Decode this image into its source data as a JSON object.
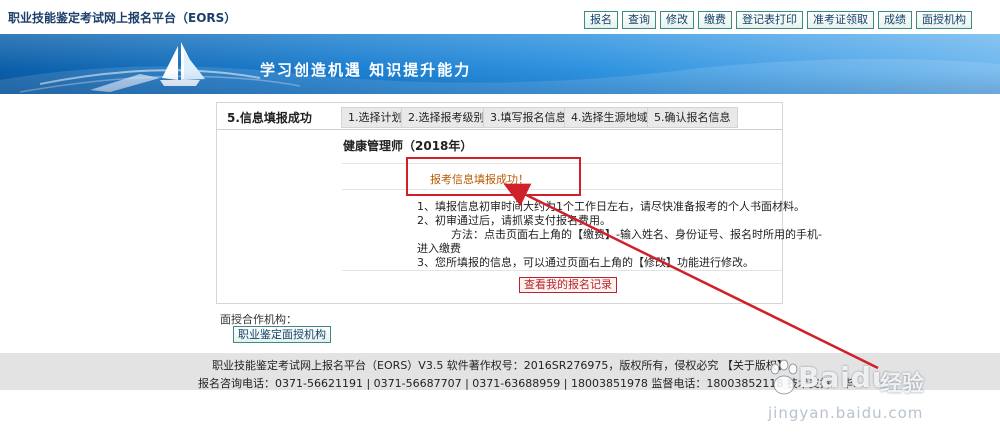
{
  "header": {
    "site_title": "职业技能鉴定考试网上报名平台（EORS）",
    "nav": [
      "报名",
      "查询",
      "修改",
      "缴费",
      "登记表打印",
      "准考证领取",
      "成绩",
      "面授机构"
    ]
  },
  "banner": {
    "motto": "学习创造机遇  知识提升能力"
  },
  "steps": {
    "current": "5.信息填报成功",
    "tabs": [
      "1.选择计划",
      "2.选择报考级别",
      "3.填写报名信息",
      "4.选择生源地域",
      "5.确认报名信息"
    ]
  },
  "main": {
    "job_title": "健康管理师（2018年）",
    "success_message": "报考信息填报成功！",
    "instructions": [
      "1、填报信息初审时间大约为1个工作日左右，请尽快准备报考的个人书面材料。",
      "2、初审通过后，请抓紧支付报名费用。",
      "方法：点击页面右上角的【缴费】-输入姓名、身份证号、报名时所用的手机-",
      "进入缴费",
      "3、您所填报的信息，可以通过页面右上角的【修改】功能进行修改。"
    ],
    "record_button": "查看我的报名记录"
  },
  "coop": {
    "label": "面授合作机构：",
    "button": "职业鉴定面授机构"
  },
  "footer": {
    "line1": "职业技能鉴定考试网上报名平台（EORS）V3.5 软件著作权号：2016SR276975，版权所有，侵权必究 【关于版权】",
    "line2": "报名咨询电话：0371-56621191 | 0371-56687707 | 0371-63688959 | 18003851978 监督电话：18003852118 技术支持：华..."
  },
  "watermark": {
    "logo": "Baidu",
    "jingyan": "经验",
    "domain": "jingyan.baidu.com"
  }
}
